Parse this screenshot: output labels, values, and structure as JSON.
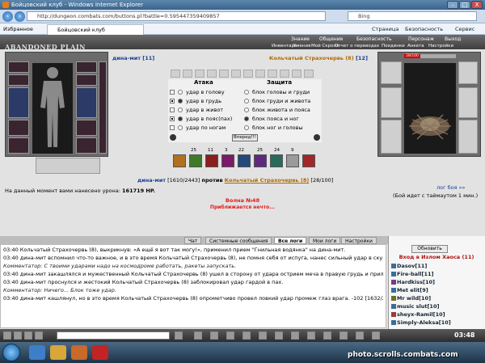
{
  "window": {
    "title": "Бойцовский клуб - Windows Internet Explorer",
    "min": "–",
    "max": "□",
    "close": "X"
  },
  "browser": {
    "url": "http://dungeon.combats.com/buttons.pl?battle=0.595447359409857",
    "search_placeholder": "Bing",
    "favorites_label": "Избранное",
    "tab_title": "Бойцовский клуб",
    "cmd_page": "Страница",
    "cmd_safety": "Безопасность",
    "cmd_service": "Сервис"
  },
  "game": {
    "logo": "ABANDONED PLAIN",
    "nav_top": [
      "Знание",
      "Общение",
      "Безопасность",
      "Персонаж",
      "Выход"
    ],
    "nav_sub": [
      "Инвентарь",
      "Умения",
      "Мой Скролл",
      "Отчет о переводах",
      "Поединки",
      "Анкета",
      "Настройки"
    ],
    "player": {
      "name": "дина-мит",
      "level": "[11]"
    },
    "enemy": {
      "name": "Кольчатый Страхочервь (8)",
      "level": "[12]"
    },
    "enemy_hp": "28/100",
    "battle": {
      "attack_header": "Атака",
      "defense_header": "Защита",
      "attacks": [
        "удар в голову",
        "удар в грудь",
        "удар в живот",
        "удар в пояс(пах)",
        "удар по ногам"
      ],
      "defenses": [
        "блок головы и груди",
        "блок груди и живота",
        "блок живота и пояса",
        "блок пояса и ног",
        "блок ног и головы"
      ],
      "forward_button": "Вперед!!!",
      "counts": [
        "25",
        "11",
        "3",
        "22",
        "25",
        "24",
        "9"
      ]
    },
    "versus": {
      "player": "дина-мит",
      "player_hp": "[1610/2443]",
      "against": "против",
      "enemy": "Кольчатый Страхочервь (8)",
      "enemy_hp": "[28/100]"
    },
    "damage_label": "На данный момент вами нанесено урона:",
    "damage_value": "161719 HP.",
    "log_link": "лог боя »»",
    "timeout": "(Бой идет с таймаутом 1 мин.)",
    "wave": "Волна №48",
    "wave_sub": "Приближается нечто..."
  },
  "chat": {
    "tabs": [
      "Чат",
      "Системные сообщения",
      "Все логи",
      "Мои логи",
      "Настройки"
    ],
    "active_tab": "Все логи",
    "lines": [
      "03:40 Кольчатый Страхочервь (8), выкрикнув: «А ещё я вот так могу!», применил прием \"Гнильная водянка\" на дина-мит.",
      "03:40 дина-мит вспомнил что-то важное, и в это время Кольчатый Страхочервь (8), не помня себя от испуга, нанес сильный удар в скулу врага. -22 [1610/2443]",
      "Комментатор: С твоими ударами надо на космодроме работать, ракеты запускать.",
      "03:40 дина-мит закашлялся и мужественный Кольчатый Страхочервь (8) ушел в сторону от удара острием меча в правую грудь и приложил контрудар.",
      "03:40 дина-мит проснулся и жестокий Кольчатый Страхочервь (8) заблокировал удар гардой в пах.",
      "Комментатор: Ничего... Блок тоже удар.",
      "03:40 дина-мит кашлянул, но в это время Кольчатый Страхочервь (8) опрометчиво провел ловкий удар промеж глаз врага. -102 [1632/2443]"
    ]
  },
  "users": {
    "refresh_button": "Обновить",
    "location": "Вход в Излом Хаоса (11)",
    "list": [
      "Dasov[11]",
      "Fire-ball[11]",
      "Hardkiss[10]",
      "Met elit[9]",
      "Mr wild[10]",
      "music slut[10]",
      "sheyx-Ramil[10]",
      "Simply-Aleksa[10]"
    ]
  },
  "clock": "03:48",
  "watermark": "photo.scrolls.combats.com"
}
